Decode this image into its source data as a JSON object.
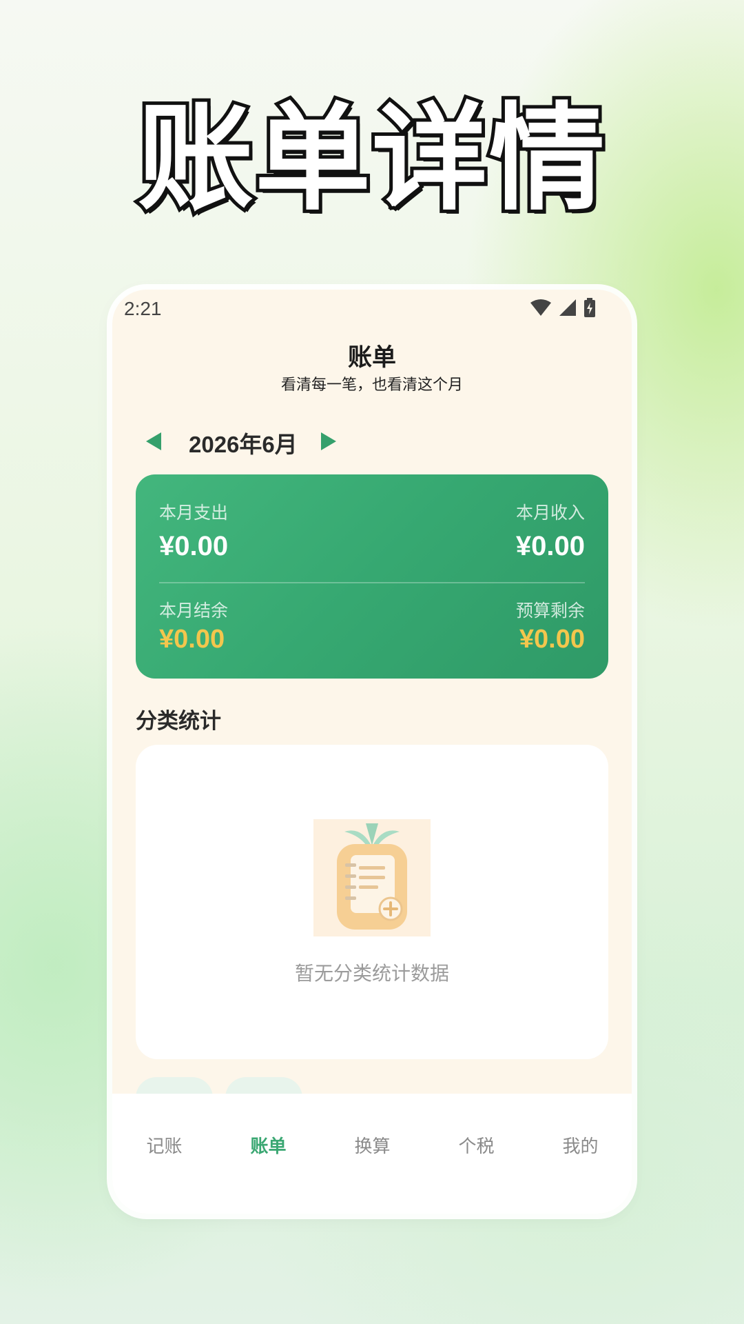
{
  "promo": {
    "title": "账单详情"
  },
  "status_bar": {
    "time": "2:21",
    "icons": [
      "wifi-icon",
      "signal-icon",
      "battery-charging-icon"
    ]
  },
  "header": {
    "title": "账单",
    "subtitle": "看清每一笔，也看清这个月"
  },
  "month_nav": {
    "label": "2026年6月",
    "prev_icon": "triangle-left-icon",
    "next_icon": "triangle-right-icon"
  },
  "summary": {
    "expense_label": "本月支出",
    "expense_value": "¥0.00",
    "income_label": "本月收入",
    "income_value": "¥0.00",
    "balance_label": "本月结余",
    "balance_value": "¥0.00",
    "budget_label": "预算剩余",
    "budget_value": "¥0.00"
  },
  "category_stats": {
    "title": "分类统计",
    "empty_text": "暂无分类统计数据"
  },
  "tabbar": {
    "items": [
      {
        "label": "记账",
        "active": false
      },
      {
        "label": "账单",
        "active": true
      },
      {
        "label": "换算",
        "active": false
      },
      {
        "label": "个税",
        "active": false
      },
      {
        "label": "我的",
        "active": false
      }
    ]
  },
  "colors": {
    "accent": "#3aa772",
    "card_green": "#36a871",
    "highlight_yellow": "#f3c64d",
    "page_bg": "#fdf6ea"
  }
}
